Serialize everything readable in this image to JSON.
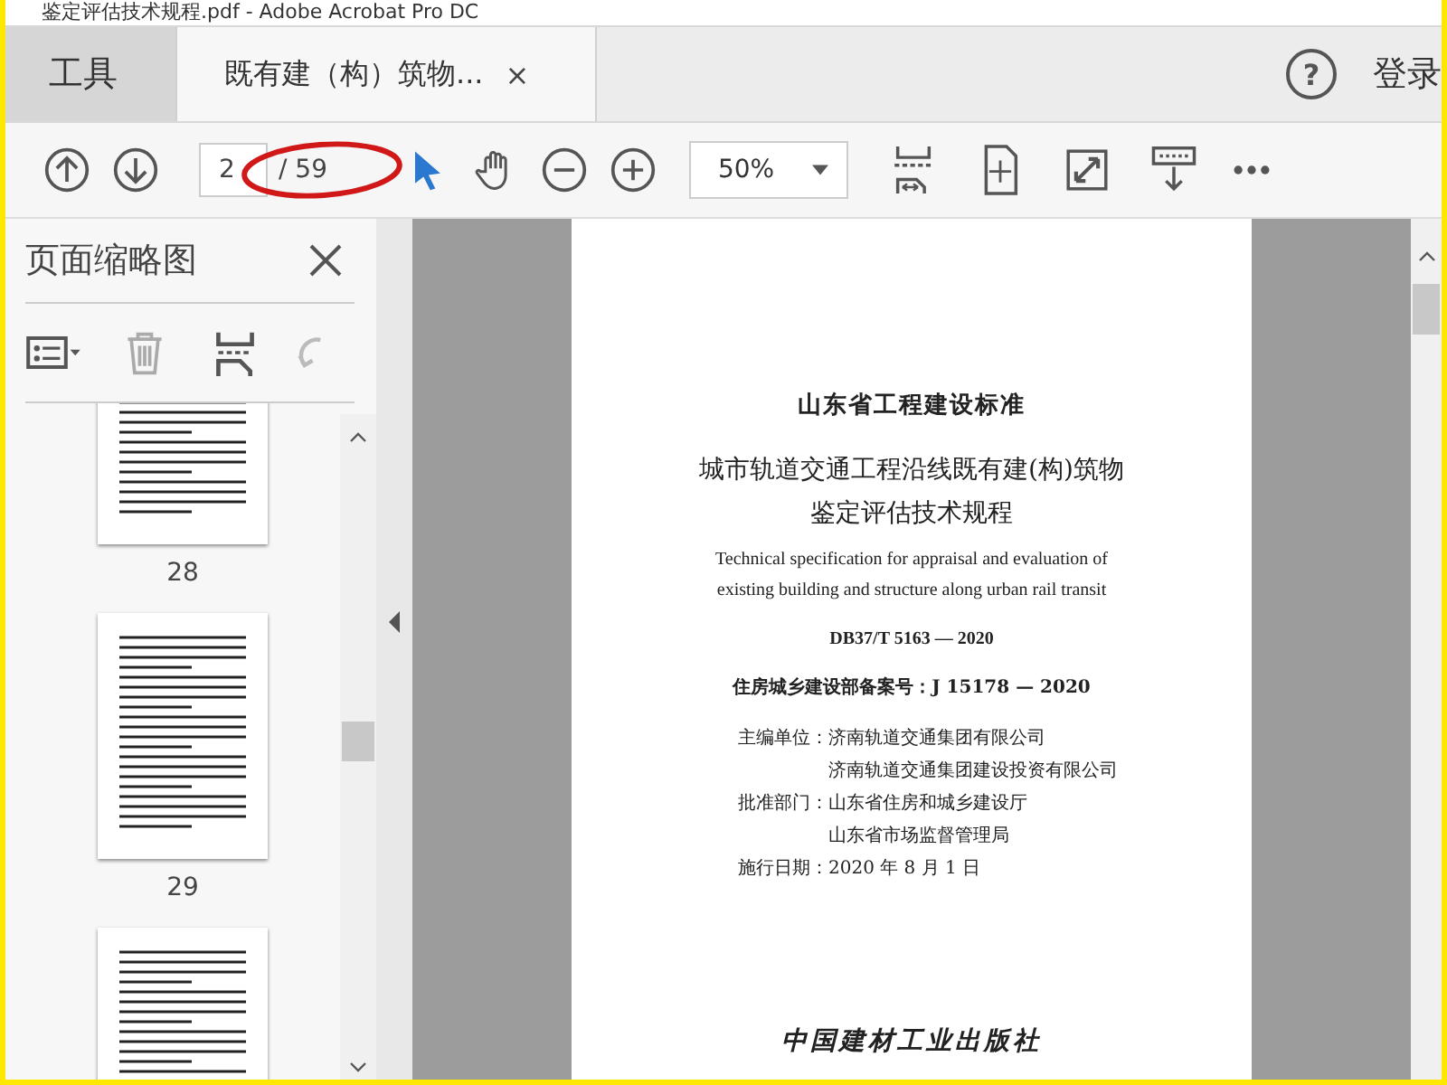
{
  "window": {
    "title": "鉴定评估技术规程.pdf - Adobe Acrobat Pro DC"
  },
  "tabs": [
    {
      "label": "工具",
      "selected": false
    },
    {
      "label": "既有建（构）筑物...",
      "selected": true,
      "close": "×"
    }
  ],
  "account": {
    "help": "?",
    "login": "登录"
  },
  "toolbar": {
    "page_value": "2",
    "page_total": "/ 59",
    "zoom": "50%",
    "annotation": true
  },
  "sidebar": {
    "title": "页面缩略图",
    "thumbnails": [
      {
        "label": "28",
        "selected": false
      },
      {
        "label": "29",
        "selected": false
      },
      {
        "selected": false
      }
    ]
  },
  "document": {
    "header": "山东省工程建设标准",
    "title_lines": [
      "城市轨道交通工程沿线既有建(构)筑物",
      "鉴定评估技术规程"
    ],
    "english_lines": [
      "Technical specification for appraisal and evaluation of",
      "existing building and structure along urban rail transit"
    ],
    "code": "DB37/T 5163 — 2020",
    "record": "住房城乡建设部备案号：J 15178 — 2020",
    "info": [
      {
        "label": "主编单位：",
        "values": [
          "济南轨道交通集团有限公司",
          "济南轨道交通集团建设投资有限公司"
        ]
      },
      {
        "label": "批准部门：",
        "values": [
          "山东省住房和城乡建设厅",
          "山东省市场监督管理局"
        ]
      },
      {
        "label": "施行日期：",
        "values": [
          "2020 年 8 月 1 日"
        ]
      }
    ],
    "publisher": "中国建材工业出版社"
  }
}
